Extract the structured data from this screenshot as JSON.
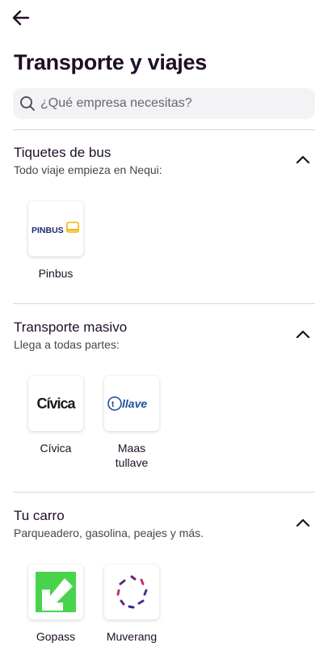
{
  "header": {
    "back_icon": "arrow-left-icon",
    "title": "Transporte y viajes"
  },
  "search": {
    "placeholder": "¿Qué empresa necesitas?",
    "icon": "search-icon"
  },
  "sections": [
    {
      "title": "Tiquetes de bus",
      "subtitle": "Todo viaje empieza en Nequi:",
      "expanded": true,
      "items": [
        {
          "label": "Pinbus",
          "logo_text": "PINBUS"
        }
      ]
    },
    {
      "title": "Transporte masivo",
      "subtitle": "Llega a todas partes:",
      "expanded": true,
      "items": [
        {
          "label": "Cívica",
          "logo_text": "Cívica"
        },
        {
          "label": "Maas\ntullave",
          "logo_text": "llave"
        }
      ]
    },
    {
      "title": "Tu carro",
      "subtitle": "Parqueadero, gasolina, peajes y más.",
      "expanded": true,
      "items": [
        {
          "label": "Gopass"
        },
        {
          "label": "Muverang"
        }
      ]
    }
  ],
  "colors": {
    "title": "#1f0f26",
    "search_bg": "#f3f2f4",
    "divider": "#d9d6db",
    "pinbus_yellow": "#f5b400",
    "pinbus_blue": "#1e2a6e",
    "tullave_blue": "#1f4fa0",
    "gopass_green": "#49d34d",
    "muverang_purple": "#5a2a82"
  }
}
